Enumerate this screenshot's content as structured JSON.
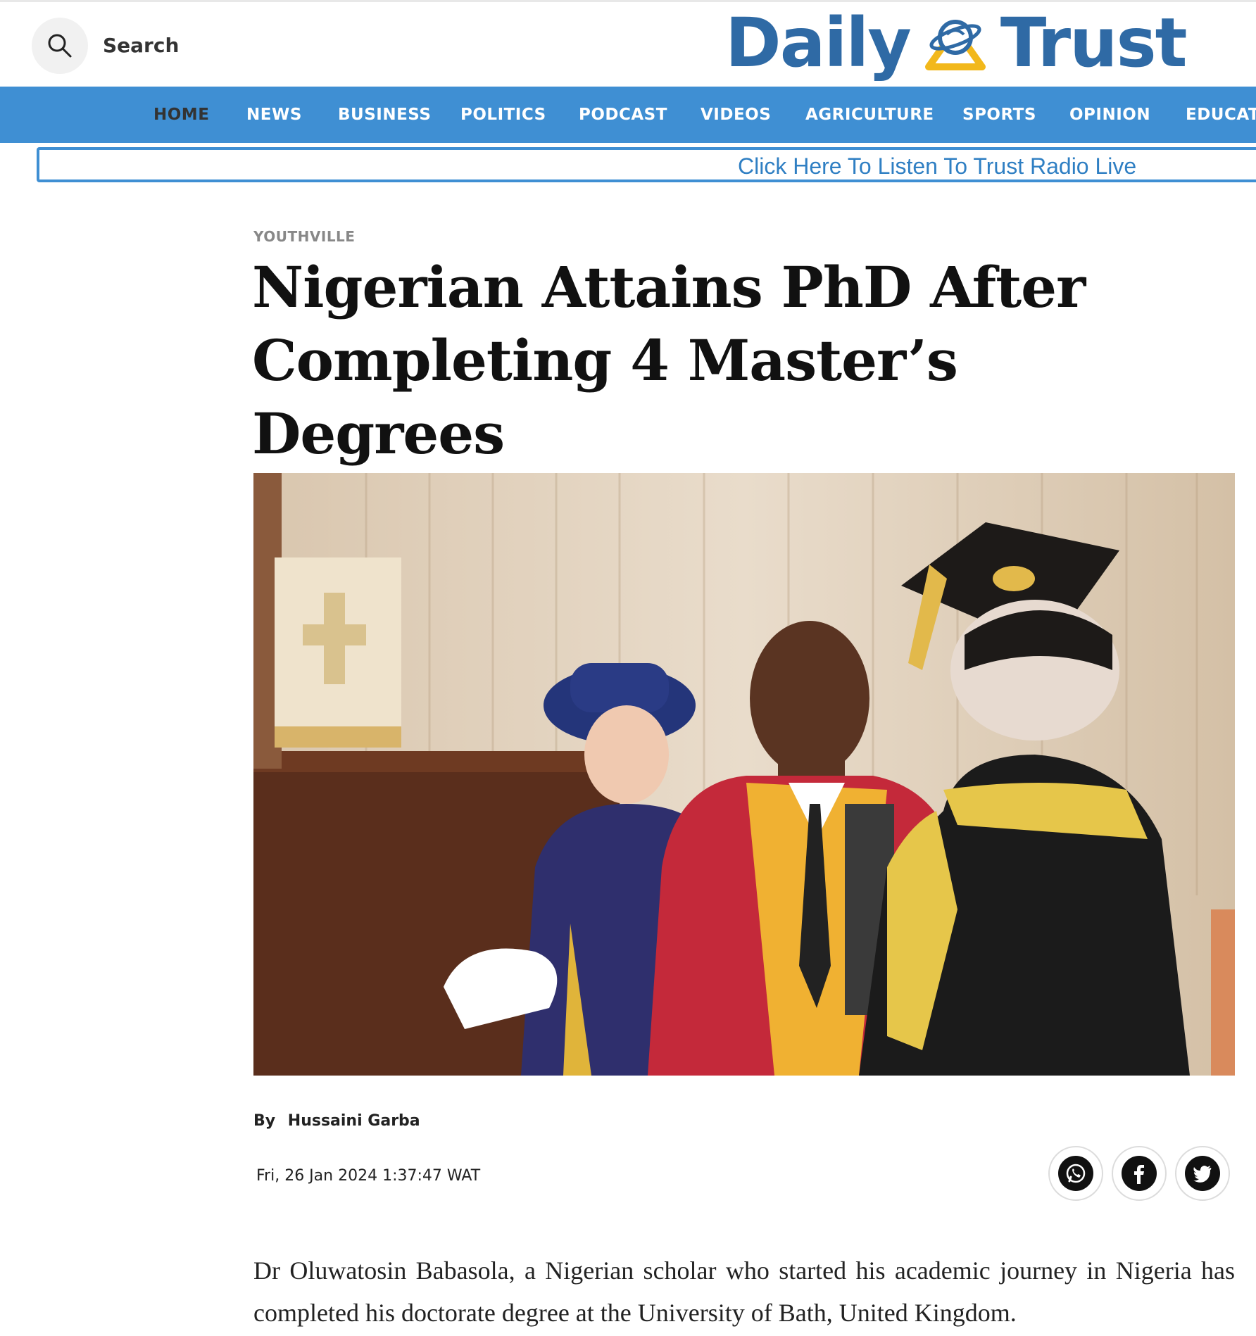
{
  "header": {
    "search_label": "Search",
    "logo_left": "Daily",
    "logo_right": "Trust",
    "brand_color": "#2f6aa5",
    "accent_color": "#f2b81b"
  },
  "nav": {
    "items": [
      {
        "label": "HOME",
        "active": true
      },
      {
        "label": "NEWS"
      },
      {
        "label": "BUSINESS"
      },
      {
        "label": "POLITICS"
      },
      {
        "label": "PODCAST"
      },
      {
        "label": "VIDEOS"
      },
      {
        "label": "AGRICULTURE"
      },
      {
        "label": "SPORTS"
      },
      {
        "label": "OPINION"
      },
      {
        "label": "EDUCATI"
      }
    ],
    "bar_color": "#3f8fd3"
  },
  "radio": {
    "link_text": "Click Here To Listen To Trust Radio Live"
  },
  "article": {
    "category": "YOUTHVILLE",
    "headline": "Nigerian Attains PhD After Completing 4 Master’s Degrees",
    "by_label": "By",
    "author": "Hussaini Garba",
    "date": "Fri, 26 Jan 2024 1:37:47 WAT",
    "body_paragraph": "Dr Oluwatosin Babasola, a Nigerian scholar who started his academic journey in Nigeria has completed his doctorate degree at the University of Bath, United Kingdom."
  },
  "share": {
    "icons": [
      "whatsapp-icon",
      "facebook-icon",
      "twitter-icon"
    ]
  }
}
